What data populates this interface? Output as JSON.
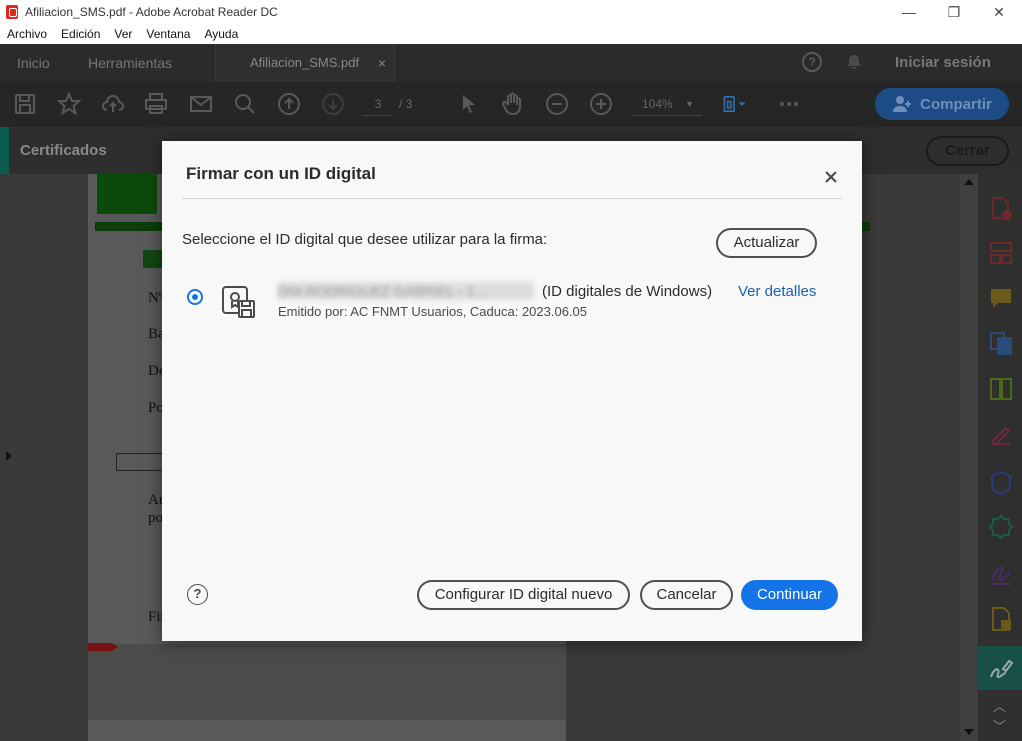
{
  "window": {
    "title": "Afiliacion_SMS.pdf - Adobe Acrobat Reader DC",
    "minimize": "—",
    "restore": "❐",
    "close": "✕"
  },
  "menu": [
    "Archivo",
    "Edición",
    "Ver",
    "Ventana",
    "Ayuda"
  ],
  "tabs": {
    "home": "Inicio",
    "tools": "Herramientas",
    "document": "Afiliacion_SMS.pdf",
    "document_close": "×",
    "help": "?",
    "signin": "Iniciar sesión"
  },
  "toolbar": {
    "page_current": "3",
    "page_total": "/ 3",
    "zoom": "104%",
    "share": "Compartir"
  },
  "certificates_bar": {
    "title": "Certificados",
    "close": "Cerrar"
  },
  "document_fragments": [
    "Nº",
    "Ba",
    "De",
    "Po",
    "Au",
    "po",
    "Fir"
  ],
  "dialog": {
    "title": "Firmar con un ID digital",
    "close": "×",
    "prompt": "Seleccione el ID digital que desee utilizar para la firma:",
    "refresh_button": "Actualizar",
    "id_entry": {
      "name_redacted": "DNI RODRIGUEZ GABRIEL - 1...",
      "source": "(ID digitales de Windows)",
      "details_link": "Ver detalles",
      "issuer": "Emitido por: AC FNMT Usuarios, Caduca: 2023.06.05",
      "selected": true
    },
    "help": "?",
    "configure_button": "Configurar ID digital nuevo",
    "cancel_button": "Cancelar",
    "continue_button": "Continuar"
  },
  "colors": {
    "accent": "#1473e6",
    "link": "#1d5fb0",
    "cert_accent": "#0d5c52"
  }
}
